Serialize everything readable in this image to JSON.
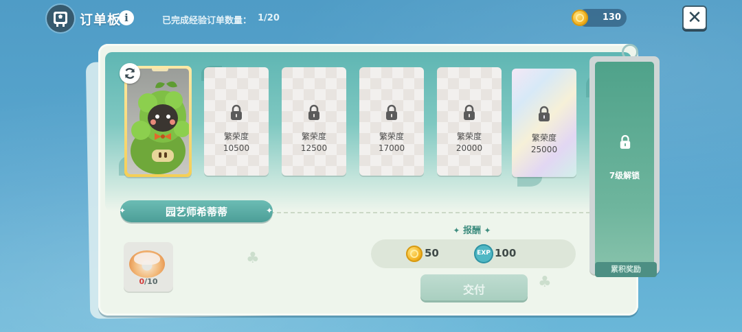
{
  "header": {
    "title": "订单板",
    "info_glyph": "i",
    "progress_label": "已完成经验订单数量：",
    "progress_value": "1/20",
    "coins": "130",
    "close_glyph": "✕"
  },
  "cards": [
    {
      "label": "繁荣度",
      "value": "10500"
    },
    {
      "label": "繁荣度",
      "value": "12500"
    },
    {
      "label": "繁荣度",
      "value": "17000"
    },
    {
      "label": "繁荣度",
      "value": "20000"
    },
    {
      "label": "繁荣度",
      "value": "25000"
    }
  ],
  "side_panel": {
    "unlock_text": "7级解锁",
    "badge": "累积奖励"
  },
  "order": {
    "name": "园艺师希蒂蒂",
    "item_have": "0",
    "item_need": "/10"
  },
  "reward": {
    "title": "报酬",
    "coin_value": "50",
    "exp_label": "EXP",
    "exp_value": "100"
  },
  "deliver_label": "交付",
  "icons": {
    "board": "order-board-icon",
    "refresh": "refresh-icon",
    "lock": "lock-icon",
    "coin": "coin-icon",
    "close": "close-icon"
  },
  "colors": {
    "teal": "#4c9e97",
    "gold_frame": "#f5cf55",
    "deliver_disabled": "#a9cfc0"
  }
}
